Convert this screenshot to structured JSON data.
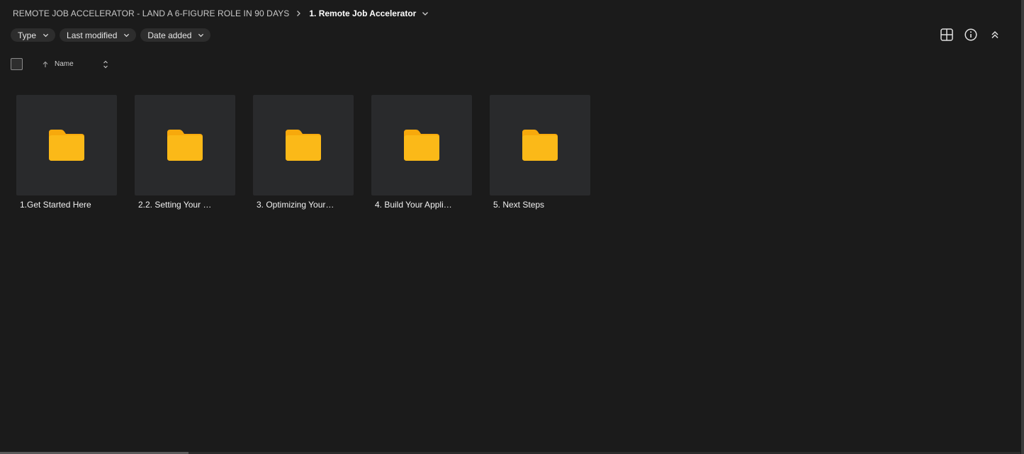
{
  "breadcrumb": {
    "root": "REMOTE JOB ACCELERATOR - LAND A 6-FIGURE ROLE IN 90 DAYS",
    "current": "1. Remote Job Accelerator",
    "separator_icon": "chevron-right-icon",
    "dropdown_icon": "chevron-down-icon"
  },
  "filters": [
    {
      "label": "Type"
    },
    {
      "label": "Last modified"
    },
    {
      "label": "Date added"
    }
  ],
  "toolbar": {
    "icons": [
      "grid-view-icon",
      "info-icon",
      "collapse-icon"
    ]
  },
  "list_header": {
    "name_label": "Name",
    "sort_direction": "ascending"
  },
  "folders": [
    {
      "label": "1.Get Started Here"
    },
    {
      "label": "2.2. Setting Your St..."
    },
    {
      "label": "3. Optimizing Your '..."
    },
    {
      "label": "4. Build Your Applic..."
    },
    {
      "label": "5. Next Steps"
    }
  ],
  "colors": {
    "background": "#1b1b1b",
    "tile": "#292a2c",
    "chip": "#2d2d2d",
    "folder": "#f9b10f"
  }
}
